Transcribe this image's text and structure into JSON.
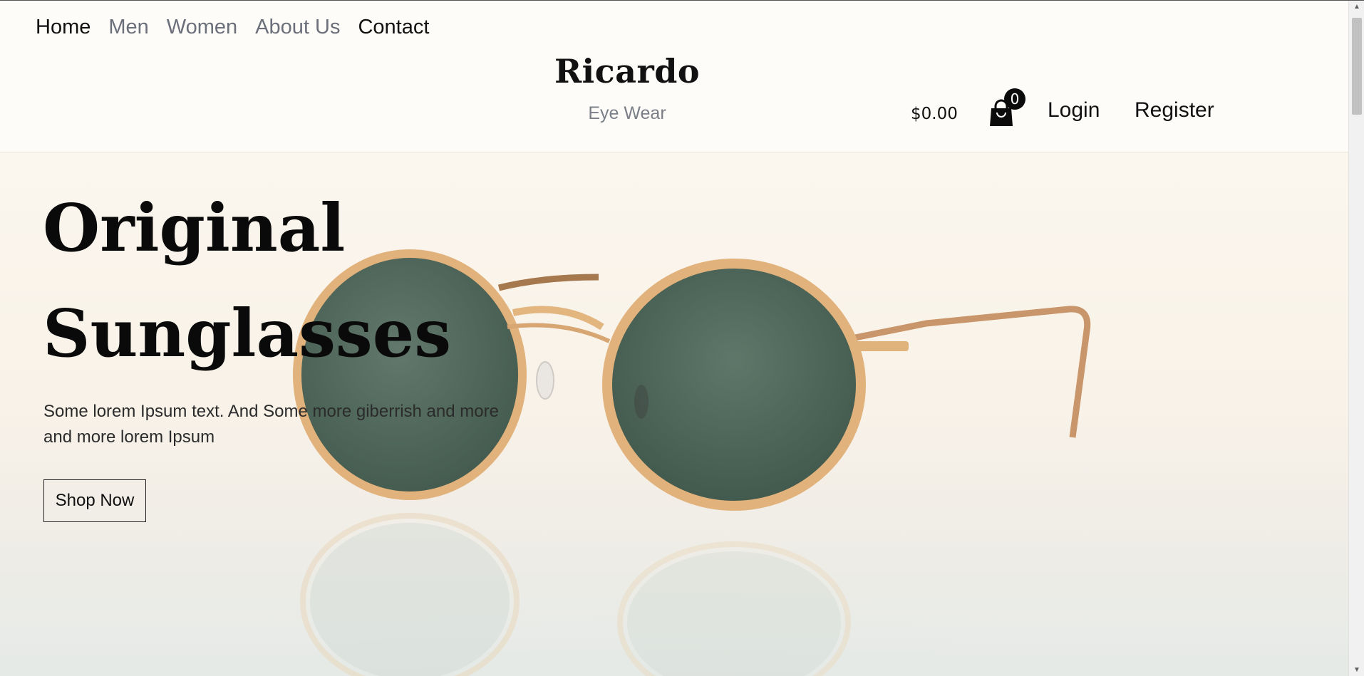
{
  "nav": {
    "items": [
      {
        "label": "Home"
      },
      {
        "label": "Men"
      },
      {
        "label": "Women"
      },
      {
        "label": "About Us"
      },
      {
        "label": "Contact"
      }
    ]
  },
  "brand": {
    "name": "Ricardo",
    "tagline": "Eye Wear"
  },
  "account": {
    "cart_total": "$0.00",
    "cart_count": "0",
    "cart_icon": "shopping-bag-icon",
    "login_label": "Login",
    "register_label": "Register"
  },
  "hero": {
    "title_line1": "Original",
    "title_line2": "Sunglasses",
    "text": "Some lorem Ipsum text. And Some more giberrish and more and more lorem Ipsum",
    "button_label": "Shop Now",
    "image_subject": "gold round sunglasses with green lenses on marble"
  },
  "colors": {
    "background": "#fdfbf6",
    "text": "#111111",
    "nav_muted": "#6b6f7a",
    "lens": "#4f6a5c",
    "frame": "#d9a970"
  }
}
